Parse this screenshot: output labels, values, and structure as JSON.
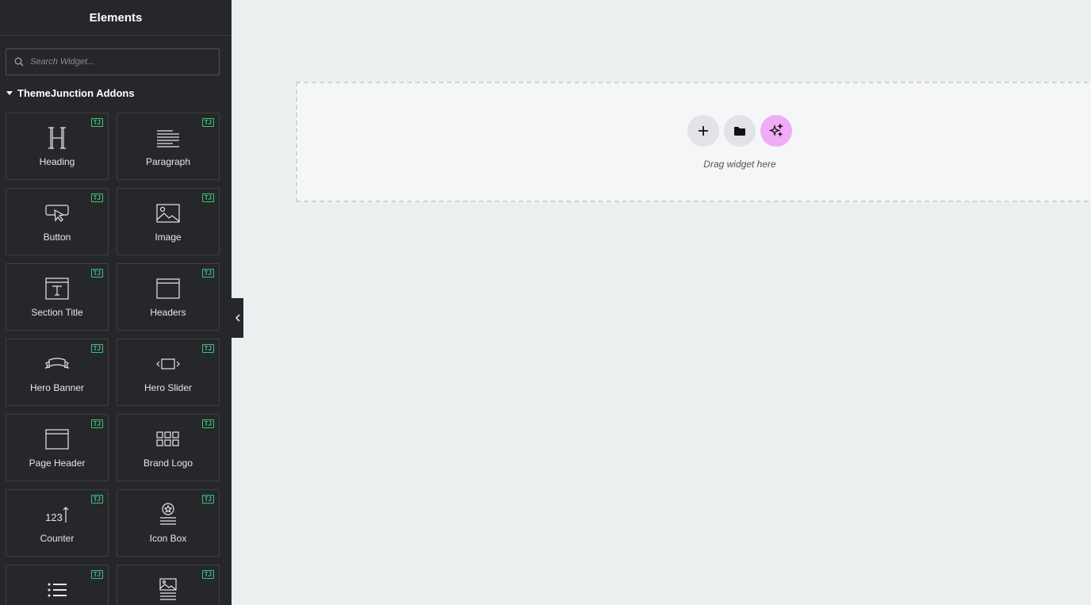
{
  "panel": {
    "title": "Elements",
    "search_placeholder": "Search Widget...",
    "category": "ThemeJunction Addons",
    "badge": "TJ",
    "widgets": [
      {
        "label": "Heading",
        "icon": "heading-icon"
      },
      {
        "label": "Paragraph",
        "icon": "paragraph-icon"
      },
      {
        "label": "Button",
        "icon": "button-icon"
      },
      {
        "label": "Image",
        "icon": "image-icon"
      },
      {
        "label": "Section Title",
        "icon": "section-title-icon"
      },
      {
        "label": "Headers",
        "icon": "headers-icon"
      },
      {
        "label": "Hero Banner",
        "icon": "hero-banner-icon"
      },
      {
        "label": "Hero Slider",
        "icon": "hero-slider-icon"
      },
      {
        "label": "Page Header",
        "icon": "page-header-icon"
      },
      {
        "label": "Brand Logo",
        "icon": "brand-logo-icon"
      },
      {
        "label": "Counter",
        "icon": "counter-icon"
      },
      {
        "label": "Icon Box",
        "icon": "icon-box-icon"
      },
      {
        "label": "",
        "icon": "list-icon"
      },
      {
        "label": "",
        "icon": "image-text-icon"
      }
    ],
    "counter_digits": "123"
  },
  "canvas": {
    "drop_text": "Drag widget here",
    "ai_color": "#f0abf7"
  }
}
